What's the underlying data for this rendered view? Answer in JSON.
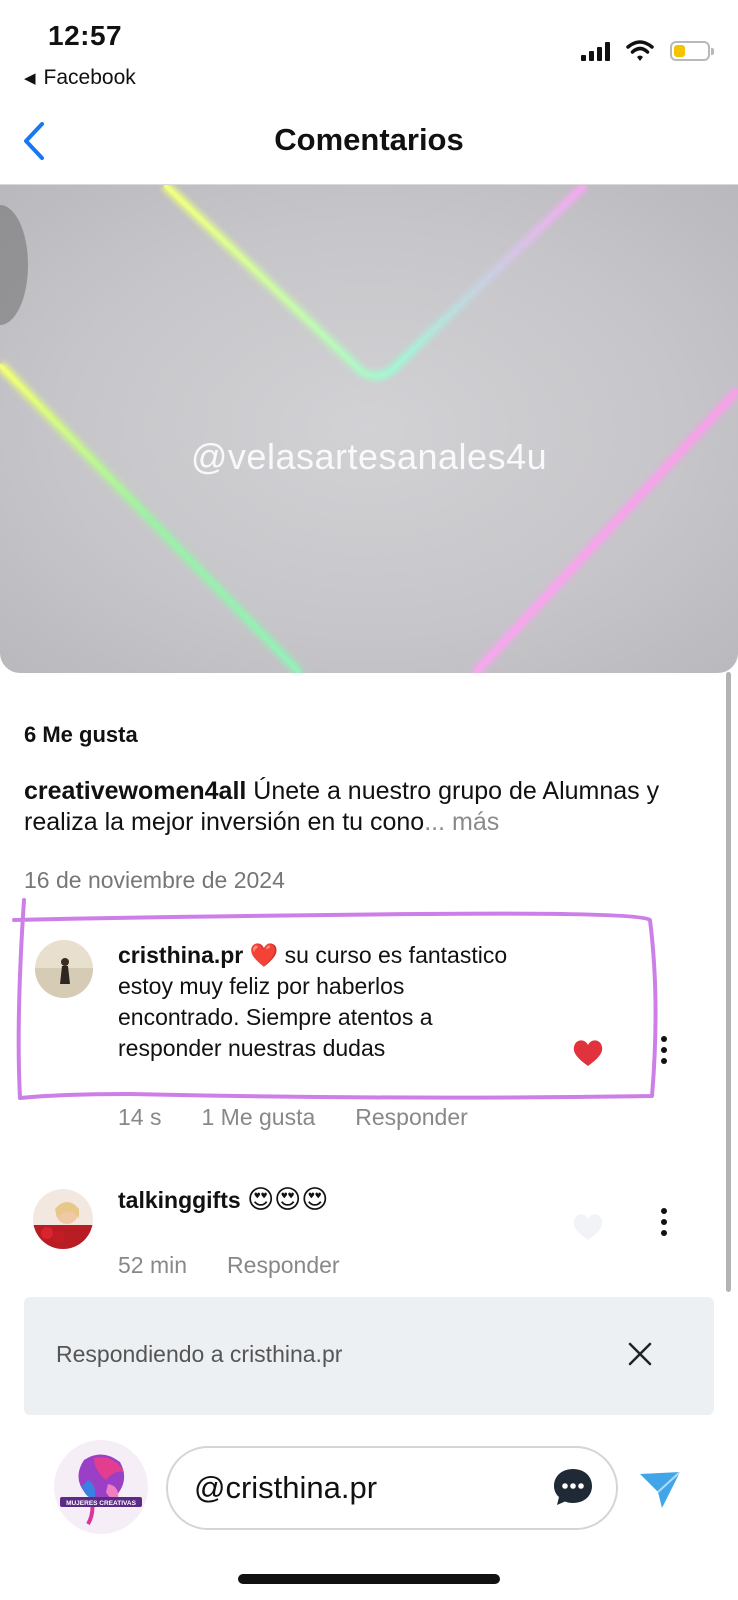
{
  "status_bar": {
    "time": "12:57",
    "back_app": "Facebook",
    "battery_color": "#f5c400",
    "battery_level": 0.35
  },
  "header": {
    "title": "Comentarios",
    "back_icon": "chevron-left-icon",
    "accent": "#1877f2"
  },
  "media": {
    "watermark": "@velasartesanales4u"
  },
  "post": {
    "likes": "6 Me gusta",
    "caption_user": "creativewomen4all",
    "caption_text": " Únete a nuestro grupo de Alumnas y realiza la mejor inversión en tu cono",
    "caption_more": "... más",
    "date": "16 de noviembre de 2024"
  },
  "comments": [
    {
      "user": "cristhina.pr",
      "emoji": "❤️",
      "text": " su curso es fantastico estoy muy feliz por haberlos encontrado. Siempre atentos a responder nuestras dudas",
      "time": "14 s",
      "likes": "1 Me gusta",
      "reply": "Responder",
      "liked": true,
      "heart_color": "#e0333d"
    },
    {
      "user": "talkinggifts",
      "emoji": "😍😍😍",
      "text": "",
      "time": "52 min",
      "reply": "Responder",
      "liked": false
    }
  ],
  "annotation_color": "#cc7fe6",
  "reply_bar": {
    "text": "Respondiendo a cristhina.pr",
    "close_icon": "close-icon"
  },
  "composer": {
    "value": "@cristhina.pr",
    "avatar_text": "MUJERES CREATIVAS",
    "emoji_icon": "chat-bubble-icon",
    "send_icon": "send-icon",
    "send_color": "#42a5e8"
  }
}
